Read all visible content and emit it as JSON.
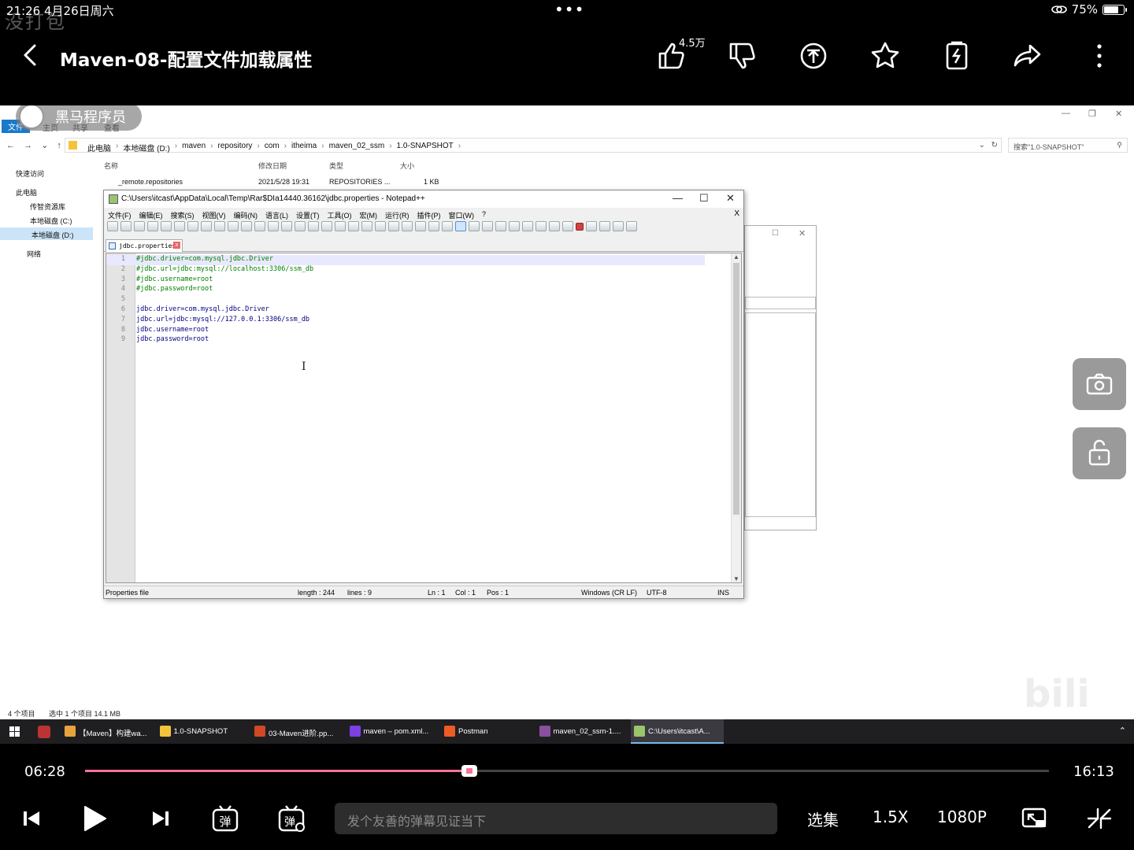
{
  "status_bar": {
    "time": "21:26",
    "date": "4月26日周六",
    "watermark": "没打包",
    "battery": "75%",
    "battery_level": 0.75
  },
  "player": {
    "title": "Maven-08-配置文件加载属性",
    "like_count": "4.5万",
    "icons": [
      "back-icon",
      "thumbs-up-icon",
      "thumbs-down-icon",
      "coin-icon",
      "star-icon",
      "charge-icon",
      "share-icon",
      "more-icon"
    ],
    "accent": "#fb7299"
  },
  "explorer": {
    "logo_text": "黑马程序员",
    "ribbon_tabs": [
      "文件",
      "主页",
      "共享",
      "查看"
    ],
    "breadcrumbs": [
      "此电脑",
      "本地磁盘 (D:)",
      "maven",
      "repository",
      "com",
      "itheima",
      "maven_02_ssm",
      "1.0-SNAPSHOT"
    ],
    "search_placeholder": "搜索\"1.0-SNAPSHOT\"",
    "sidebar": [
      "快速访问",
      "此电脑",
      "传智资源库",
      "本地磁盘 (C:)",
      "本地磁盘 (D:)",
      "网络"
    ],
    "columns": [
      "名称",
      "修改日期",
      "类型",
      "大小"
    ],
    "files": [
      {
        "name": "_remote.repositories",
        "date": "2021/5/28 19:31",
        "type": "REPOSITORIES ...",
        "size": "1 KB"
      }
    ],
    "status_count": "4 个项目",
    "status_selected": "选中 1 个项目  14.1 MB"
  },
  "notepad": {
    "title": "C:\\Users\\itcast\\AppData\\Local\\Temp\\Rar$DIa14440.36162\\jdbc.properties - Notepad++",
    "menu": [
      "文件(F)",
      "编辑(E)",
      "搜索(S)",
      "视图(V)",
      "编码(N)",
      "语言(L)",
      "设置(T)",
      "工具(O)",
      "宏(M)",
      "运行(R)",
      "插件(P)",
      "窗口(W)",
      "?"
    ],
    "menu_close": "X",
    "tab": "jdbc.properties",
    "lines": [
      {
        "no": "1",
        "text": "#jdbc.driver=com.mysql.jdbc.Driver"
      },
      {
        "no": "2",
        "text": "#jdbc.url=jdbc:mysql://localhost:3306/ssm_db"
      },
      {
        "no": "3",
        "text": "#jdbc.username=root"
      },
      {
        "no": "4",
        "text": "#jdbc.password=root"
      },
      {
        "no": "5",
        "text": ""
      },
      {
        "no": "6",
        "text": "jdbc.driver=com.mysql.jdbc.Driver"
      },
      {
        "no": "7",
        "text": "jdbc.url=jdbc:mysql://127.0.0.1:3306/ssm_db"
      },
      {
        "no": "8",
        "text": "jdbc.username=root"
      },
      {
        "no": "9",
        "text": "jdbc.password=root"
      }
    ],
    "status": {
      "type": "Properties file",
      "length": "length : 244",
      "lines": "lines : 9",
      "ln": "Ln : 1",
      "col": "Col : 1",
      "pos": "Pos : 1",
      "eol": "Windows (CR LF)",
      "encoding": "UTF-8",
      "mode": "INS"
    }
  },
  "taskbar": {
    "items": [
      {
        "label": "【Maven】构建wa...",
        "color": "#e8a33d"
      },
      {
        "label": "1.0-SNAPSHOT",
        "color": "#f3c43b"
      },
      {
        "label": "03-Maven进阶.pp...",
        "color": "#d24726"
      },
      {
        "label": "maven – pom.xml...",
        "color": "#7b3fe4"
      },
      {
        "label": "Postman",
        "color": "#ef5b25"
      },
      {
        "label": "maven_02_ssm-1....",
        "color": "#8a4f9e"
      },
      {
        "label": "C:\\Users\\itcast\\A...",
        "color": "#9bc56b"
      }
    ]
  },
  "playback": {
    "current_time": "06:28",
    "total_time": "16:13",
    "progress": 0.399,
    "danmaku_placeholder": "发个友善的弹幕见证当下",
    "episodes_label": "选集",
    "speed_label": "1.5X",
    "quality_label": "1080P"
  }
}
